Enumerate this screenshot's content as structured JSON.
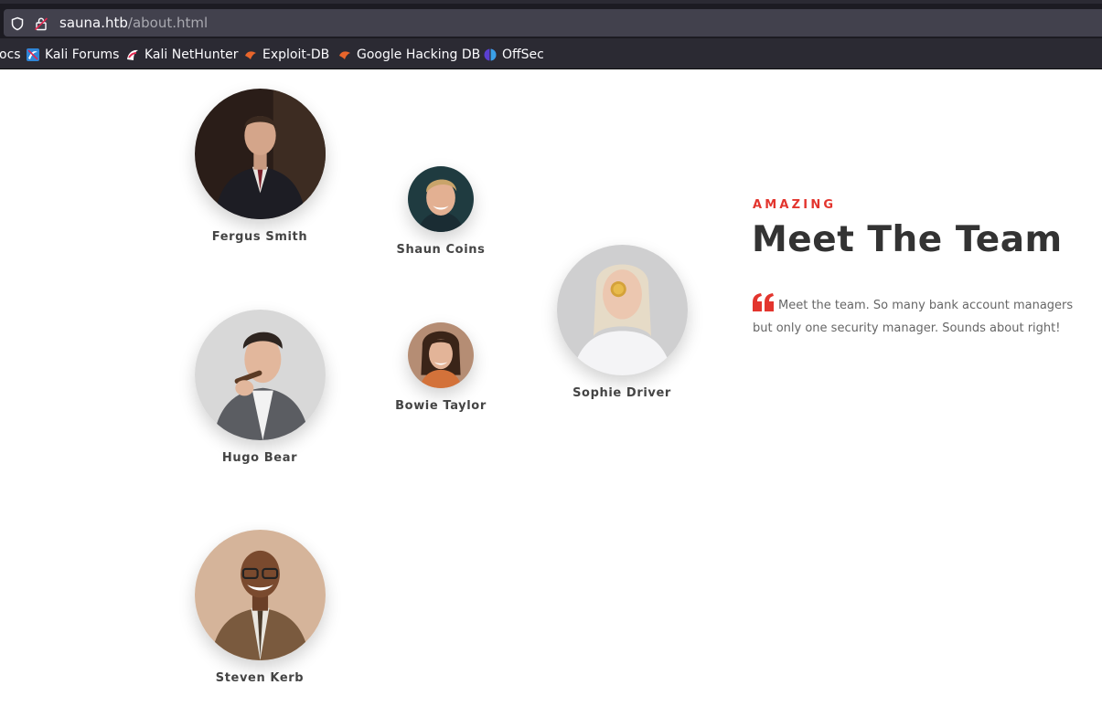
{
  "browser": {
    "url_host": "sauna.htb",
    "url_path": "/about.html",
    "bookmarks": [
      {
        "label": "ocs",
        "icon": "docs-icon"
      },
      {
        "label": "Kali Forums",
        "icon": "kali-forums-icon"
      },
      {
        "label": "Kali NetHunter",
        "icon": "kali-nethunter-icon"
      },
      {
        "label": "Exploit-DB",
        "icon": "exploit-db-icon"
      },
      {
        "label": "Google Hacking DB",
        "icon": "google-hacking-db-icon"
      },
      {
        "label": "OffSec",
        "icon": "offsec-icon"
      }
    ]
  },
  "team": {
    "eyebrow": "AMAZING",
    "title": "Meet The Team",
    "quote": "Meet the team. So many bank account managers but only one security manager. Sounds about right!",
    "accent_color": "#e3352e",
    "members": [
      {
        "name": "Fergus Smith"
      },
      {
        "name": "Shaun Coins"
      },
      {
        "name": "Sophie Driver"
      },
      {
        "name": "Hugo Bear"
      },
      {
        "name": "Bowie Taylor"
      },
      {
        "name": "Steven Kerb"
      }
    ]
  }
}
